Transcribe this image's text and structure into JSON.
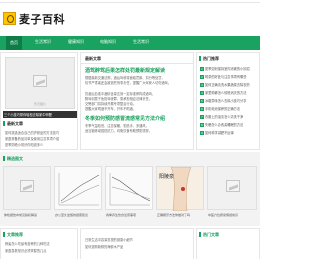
{
  "site": {
    "logo_text": "麦子百科"
  },
  "nav": {
    "items": [
      "首页",
      "生活常识",
      "健康知识",
      "电脑知识",
      "生活常识"
    ]
  },
  "left_panel": {
    "image_caption": "暂无图片",
    "overlay_text": "三个小技巧帮你轻松去除家中甲醛",
    "title": "最新文章",
    "lines": [
      "如何挑选适合自己的护肤品的方法技巧",
      "家庭常备药品清单及使用注意事项介绍",
      "夏季防晒小常识你知道多少"
    ]
  },
  "middle_panel": {
    "title": "最新文章",
    "headline1": "酒驾醉驾后果怎样处罚最新规定解读",
    "lines1": [
      "根据最新交通法规，酒后驾驶将面临罚款、扣分等处罚，",
      "情节严重者还会被追究刑事责任，提醒广大驾驶人切勿酒驾。"
    ],
    "lines2": [
      "饮酒后血液中酒精含量达到一定标准即构成酒驾，",
      "醉驾则属于危险驾驶罪，需承担相应法律责任。",
      "交警部门将持续开展专项整治行动。",
      "提醒大家喝酒不开车，开车不喝酒。"
    ],
    "headline2": "冬季如何预防感冒流感常见方法介绍",
    "lines3": [
      "冬季气温较低，注意保暖、勤洗手、多通风，",
      "适当锻炼增强抵抗力，均衡饮食有助预防感冒。"
    ]
  },
  "right_panel": {
    "title": "热门推荐",
    "items": [
      "夏季如何保持室内凉爽的小妙招",
      "喝茶的好处与注意事项有哪些",
      "如何正确清洗水果蔬菜去除农药",
      "家里蟑螂怎么彻底消灭的方法",
      "冰箱异味怎么去除小技巧分享",
      "手机电池保养的正确方法",
      "衣服上的油渍怎么清洗干净",
      "失眠怎么办改善睡眠的方法",
      "如何科学减肥不反弹"
    ]
  },
  "featured": {
    "title": "精选图文",
    "captions": [
      "体检报告中常见指标解读",
      "办公室久坐族的健康建议",
      "春季养生饮食注意事项",
      "正确刷牙方法你做对了吗",
      "中医穴位按摩保健常识"
    ],
    "image_text": "阳陵泉"
  },
  "bottom": {
    "left_title": "文章推荐",
    "left_lines": [
      "蜂蜜怎么吃最有营养的几种吃法",
      "家庭急救常识必须掌握的几点"
    ],
    "middle_lines": [
      "日常生活中容易忽视的健康小细节",
      "如何选购新鲜的海鲜水产品"
    ],
    "right_title": "热门文章"
  }
}
